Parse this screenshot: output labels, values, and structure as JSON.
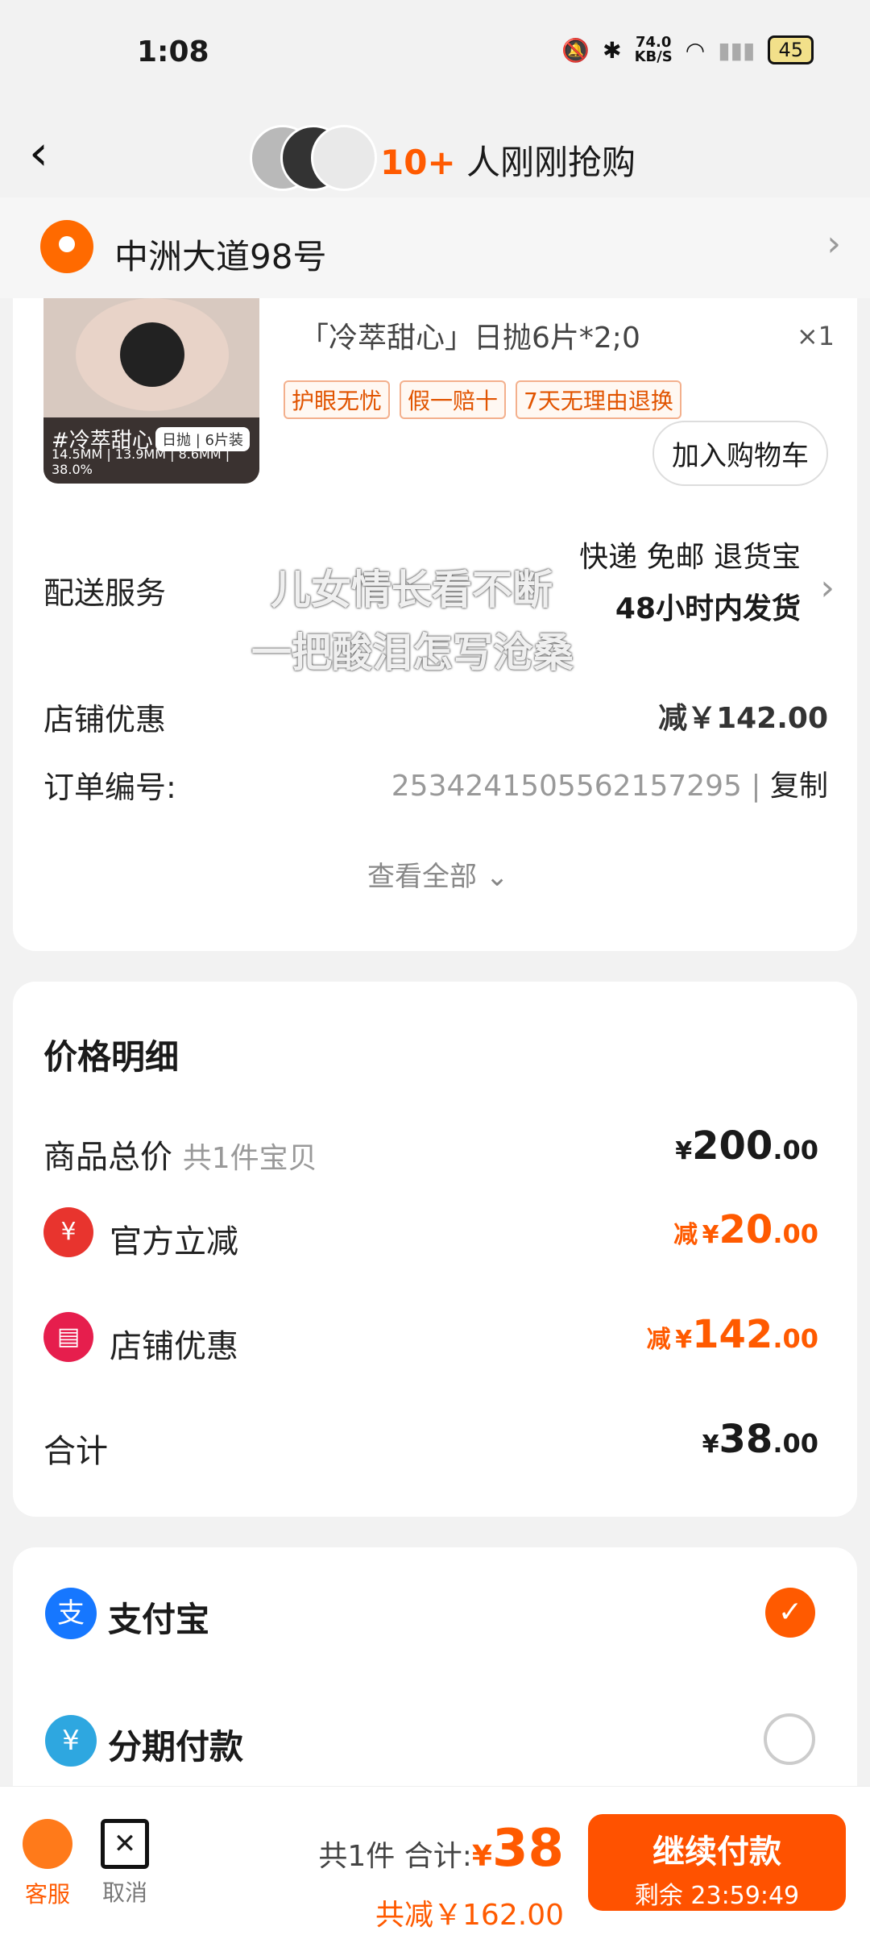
{
  "status_bar": {
    "time": "1:08",
    "net_speed_top": "74.0",
    "net_speed_unit": "KB/S",
    "battery": "45"
  },
  "header": {
    "buyers_count": "10+",
    "buyers_text": "人刚刚抢购"
  },
  "address": {
    "text": "中洲大道98号"
  },
  "product": {
    "image_label": "#冷萃甜心",
    "image_tag": "日抛 | 6片装",
    "image_specs": "14.5MM | 13.9MM | 8.6MM | 38.0%",
    "variant": "「冷萃甜心」日抛6片*2;0",
    "quantity": "×1",
    "tags": [
      "护眼无忧",
      "假一赔十",
      "7天无理由退换"
    ],
    "add_to_cart": "加入购物车"
  },
  "order_info": {
    "shipping_label": "配送服务",
    "shipping_line1": "快递 免邮 退货宝",
    "shipping_line2": "48小时内发货",
    "shop_discount_label": "店铺优惠",
    "shop_discount_value": "减￥142.00",
    "order_no_label": "订单编号:",
    "order_no": "2534241505562157295",
    "copy_label": "复制",
    "view_all": "查看全部"
  },
  "lyrics": {
    "line1": "儿女情长看不断",
    "line2": "一把酸泪怎写沧桑"
  },
  "price_detail": {
    "title": "价格明细",
    "total_label": "商品总价",
    "total_sub": "共1件宝贝",
    "total_big": "200",
    "total_small": ".00",
    "official_label": "官方立减",
    "official_prefix": "减",
    "official_big": "20",
    "official_small": ".00",
    "shop_label": "店铺优惠",
    "shop_prefix": "减",
    "shop_big": "142",
    "shop_small": ".00",
    "sum_label": "合计",
    "sum_big": "38",
    "sum_small": ".00",
    "yen": "¥"
  },
  "payment": {
    "alipay_label": "支付宝",
    "installment_label": "分期付款"
  },
  "bottom": {
    "service_label": "客服",
    "cancel_label": "取消",
    "count_text": "共1件 合计:",
    "yen": "¥",
    "total": "38",
    "saved": "共减￥162.00",
    "pay_button": "继续付款",
    "timer": "剩余 23:59:49"
  },
  "colors": {
    "accent": "#ff5a00",
    "alipay": "#1677ff",
    "installment": "#2ea7e0",
    "official": "#e8342e"
  }
}
